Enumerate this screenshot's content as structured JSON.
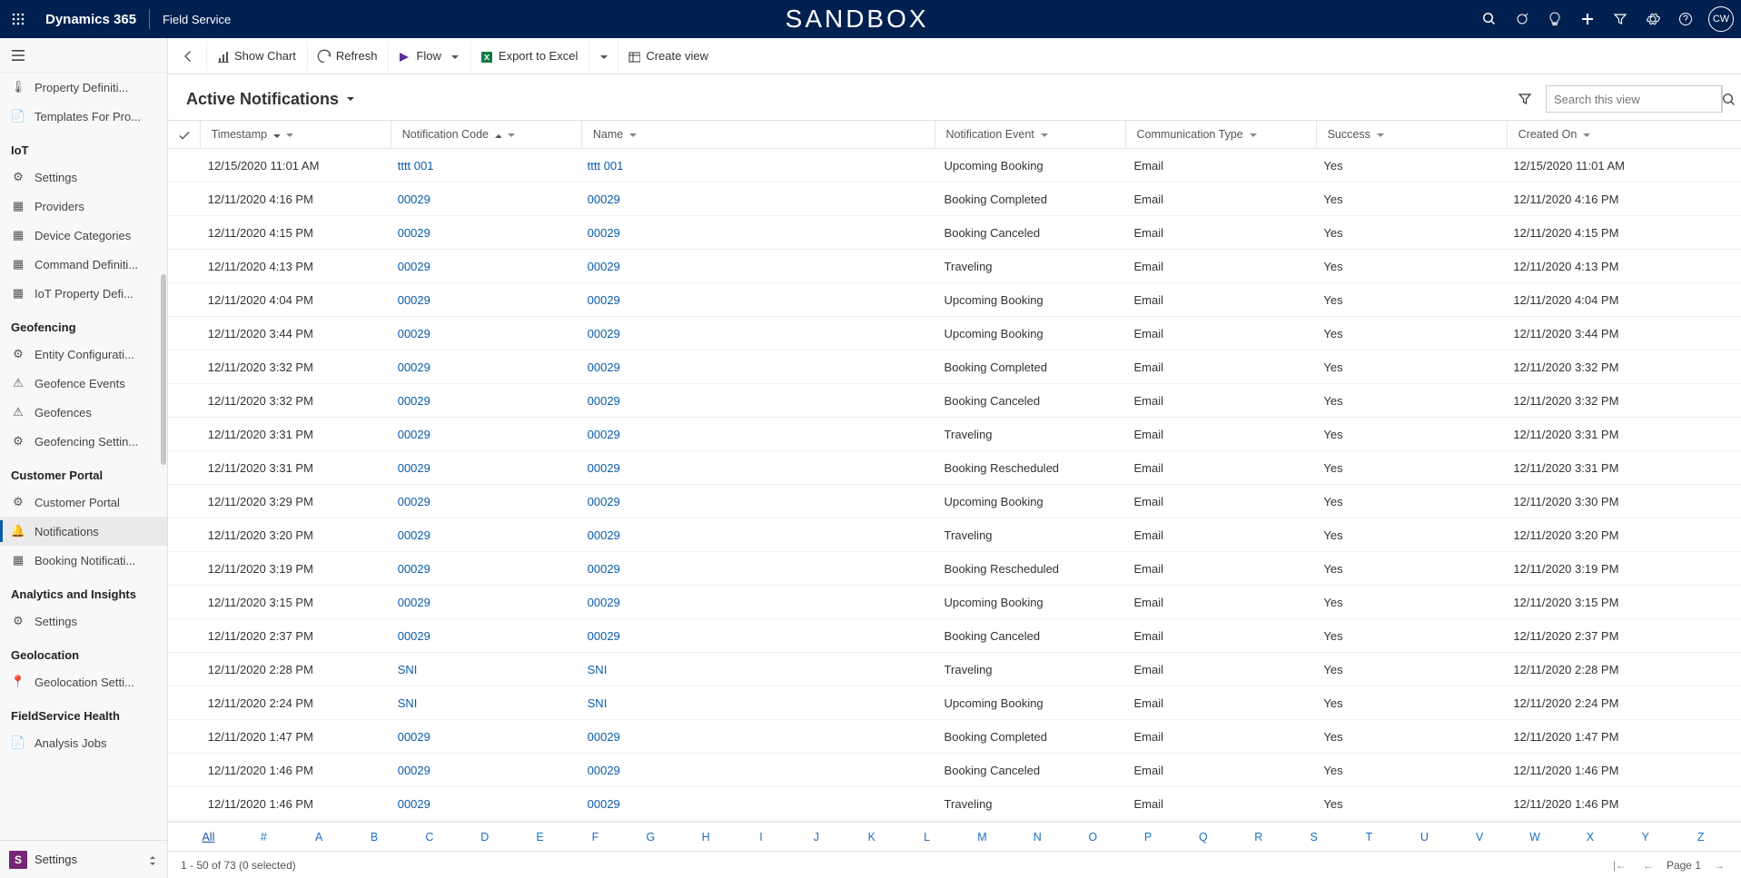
{
  "header": {
    "brand": "Dynamics 365",
    "module": "Field Service",
    "center": "SANDBOX",
    "avatar_initials": "CW"
  },
  "commandbar": {
    "show_chart": "Show Chart",
    "refresh": "Refresh",
    "flow": "Flow",
    "export_excel": "Export to Excel",
    "create_view": "Create view"
  },
  "view": {
    "title": "Active Notifications",
    "search_placeholder": "Search this view"
  },
  "sidebar": {
    "top_items": [
      {
        "icon": "thermo",
        "label": "Property Definiti..."
      },
      {
        "icon": "doc",
        "label": "Templates For Pro..."
      }
    ],
    "sections": [
      {
        "title": "IoT",
        "items": [
          {
            "icon": "sliders",
            "label": "Settings"
          },
          {
            "icon": "grid",
            "label": "Providers"
          },
          {
            "icon": "grid",
            "label": "Device Categories"
          },
          {
            "icon": "grid",
            "label": "Command Definiti..."
          },
          {
            "icon": "grid",
            "label": "IoT Property Defi..."
          }
        ]
      },
      {
        "title": "Geofencing",
        "items": [
          {
            "icon": "gear",
            "label": "Entity Configurati..."
          },
          {
            "icon": "warn",
            "label": "Geofence Events"
          },
          {
            "icon": "warn",
            "label": "Geofences"
          },
          {
            "icon": "gear",
            "label": "Geofencing Settin..."
          }
        ]
      },
      {
        "title": "Customer Portal",
        "items": [
          {
            "icon": "gear",
            "label": "Customer Portal"
          },
          {
            "icon": "bell",
            "label": "Notifications",
            "active": true
          },
          {
            "icon": "grid",
            "label": "Booking Notificati..."
          }
        ]
      },
      {
        "title": "Analytics and Insights",
        "items": [
          {
            "icon": "gear",
            "label": "Settings"
          }
        ]
      },
      {
        "title": "Geolocation",
        "items": [
          {
            "icon": "pin",
            "label": "Geolocation Setti..."
          }
        ]
      },
      {
        "title": "FieldService Health",
        "items": [
          {
            "icon": "doc",
            "label": "Analysis Jobs"
          }
        ]
      }
    ],
    "footer": {
      "tile": "S",
      "label": "Settings"
    }
  },
  "columns": [
    {
      "key": "timestamp",
      "label": "Timestamp",
      "sort": "down"
    },
    {
      "key": "code",
      "label": "Notification Code",
      "sort": "up"
    },
    {
      "key": "name",
      "label": "Name"
    },
    {
      "key": "event",
      "label": "Notification Event"
    },
    {
      "key": "comm",
      "label": "Communication Type"
    },
    {
      "key": "success",
      "label": "Success"
    },
    {
      "key": "created",
      "label": "Created On"
    }
  ],
  "rows": [
    {
      "timestamp": "12/15/2020 11:01 AM",
      "code": "tttt 001",
      "name": "tttt 001",
      "event": "Upcoming Booking",
      "comm": "Email",
      "success": "Yes",
      "created": "12/15/2020 11:01 AM"
    },
    {
      "timestamp": "12/11/2020 4:16 PM",
      "code": "00029",
      "name": "00029",
      "event": "Booking Completed",
      "comm": "Email",
      "success": "Yes",
      "created": "12/11/2020 4:16 PM"
    },
    {
      "timestamp": "12/11/2020 4:15 PM",
      "code": "00029",
      "name": "00029",
      "event": "Booking Canceled",
      "comm": "Email",
      "success": "Yes",
      "created": "12/11/2020 4:15 PM"
    },
    {
      "timestamp": "12/11/2020 4:13 PM",
      "code": "00029",
      "name": "00029",
      "event": "Traveling",
      "comm": "Email",
      "success": "Yes",
      "created": "12/11/2020 4:13 PM"
    },
    {
      "timestamp": "12/11/2020 4:04 PM",
      "code": "00029",
      "name": "00029",
      "event": "Upcoming Booking",
      "comm": "Email",
      "success": "Yes",
      "created": "12/11/2020 4:04 PM"
    },
    {
      "timestamp": "12/11/2020 3:44 PM",
      "code": "00029",
      "name": "00029",
      "event": "Upcoming Booking",
      "comm": "Email",
      "success": "Yes",
      "created": "12/11/2020 3:44 PM"
    },
    {
      "timestamp": "12/11/2020 3:32 PM",
      "code": "00029",
      "name": "00029",
      "event": "Booking Completed",
      "comm": "Email",
      "success": "Yes",
      "created": "12/11/2020 3:32 PM"
    },
    {
      "timestamp": "12/11/2020 3:32 PM",
      "code": "00029",
      "name": "00029",
      "event": "Booking Canceled",
      "comm": "Email",
      "success": "Yes",
      "created": "12/11/2020 3:32 PM"
    },
    {
      "timestamp": "12/11/2020 3:31 PM",
      "code": "00029",
      "name": "00029",
      "event": "Traveling",
      "comm": "Email",
      "success": "Yes",
      "created": "12/11/2020 3:31 PM"
    },
    {
      "timestamp": "12/11/2020 3:31 PM",
      "code": "00029",
      "name": "00029",
      "event": "Booking Rescheduled",
      "comm": "Email",
      "success": "Yes",
      "created": "12/11/2020 3:31 PM"
    },
    {
      "timestamp": "12/11/2020 3:29 PM",
      "code": "00029",
      "name": "00029",
      "event": "Upcoming Booking",
      "comm": "Email",
      "success": "Yes",
      "created": "12/11/2020 3:30 PM"
    },
    {
      "timestamp": "12/11/2020 3:20 PM",
      "code": "00029",
      "name": "00029",
      "event": "Traveling",
      "comm": "Email",
      "success": "Yes",
      "created": "12/11/2020 3:20 PM"
    },
    {
      "timestamp": "12/11/2020 3:19 PM",
      "code": "00029",
      "name": "00029",
      "event": "Booking Rescheduled",
      "comm": "Email",
      "success": "Yes",
      "created": "12/11/2020 3:19 PM"
    },
    {
      "timestamp": "12/11/2020 3:15 PM",
      "code": "00029",
      "name": "00029",
      "event": "Upcoming Booking",
      "comm": "Email",
      "success": "Yes",
      "created": "12/11/2020 3:15 PM"
    },
    {
      "timestamp": "12/11/2020 2:37 PM",
      "code": "00029",
      "name": "00029",
      "event": "Booking Canceled",
      "comm": "Email",
      "success": "Yes",
      "created": "12/11/2020 2:37 PM"
    },
    {
      "timestamp": "12/11/2020 2:28 PM",
      "code": "SNI",
      "name": "SNI",
      "event": "Traveling",
      "comm": "Email",
      "success": "Yes",
      "created": "12/11/2020 2:28 PM"
    },
    {
      "timestamp": "12/11/2020 2:24 PM",
      "code": "SNI",
      "name": "SNI",
      "event": "Upcoming Booking",
      "comm": "Email",
      "success": "Yes",
      "created": "12/11/2020 2:24 PM"
    },
    {
      "timestamp": "12/11/2020 1:47 PM",
      "code": "00029",
      "name": "00029",
      "event": "Booking Completed",
      "comm": "Email",
      "success": "Yes",
      "created": "12/11/2020 1:47 PM"
    },
    {
      "timestamp": "12/11/2020 1:46 PM",
      "code": "00029",
      "name": "00029",
      "event": "Booking Canceled",
      "comm": "Email",
      "success": "Yes",
      "created": "12/11/2020 1:46 PM"
    },
    {
      "timestamp": "12/11/2020 1:46 PM",
      "code": "00029",
      "name": "00029",
      "event": "Traveling",
      "comm": "Email",
      "success": "Yes",
      "created": "12/11/2020 1:46 PM"
    }
  ],
  "alphabar": [
    "All",
    "#",
    "A",
    "B",
    "C",
    "D",
    "E",
    "F",
    "G",
    "H",
    "I",
    "J",
    "K",
    "L",
    "M",
    "N",
    "O",
    "P",
    "Q",
    "R",
    "S",
    "T",
    "U",
    "V",
    "W",
    "X",
    "Y",
    "Z"
  ],
  "status": {
    "range": "1 - 50 of 73 (0 selected)",
    "page": "Page 1"
  }
}
